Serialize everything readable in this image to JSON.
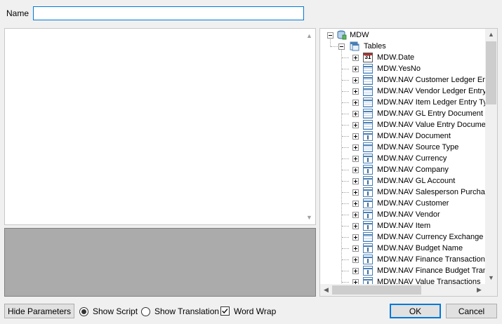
{
  "form": {
    "name_label": "Name",
    "name_value": ""
  },
  "tree": {
    "root": {
      "label": "MDW",
      "icon": "database-icon",
      "expanded": true
    },
    "group": {
      "label": "Tables",
      "icon": "tables-folder-icon",
      "expanded": true
    },
    "items": [
      {
        "label": "MDW.Date",
        "icon": "date-table-icon"
      },
      {
        "label": "MDW.YesNo",
        "icon": "table-icon"
      },
      {
        "label": "MDW.NAV Customer Ledger Ent",
        "icon": "table-icon"
      },
      {
        "label": "MDW.NAV Vendor Ledger Entry",
        "icon": "table-icon"
      },
      {
        "label": "MDW.NAV Item Ledger Entry Ty",
        "icon": "table-icon"
      },
      {
        "label": "MDW.NAV GL Entry Document T",
        "icon": "table-icon"
      },
      {
        "label": "MDW.NAV Value Entry Documen",
        "icon": "table-icon"
      },
      {
        "label": "MDW.NAV Document",
        "icon": "dimension-table-icon"
      },
      {
        "label": "MDW.NAV Source Type",
        "icon": "table-icon"
      },
      {
        "label": "MDW.NAV Currency",
        "icon": "dimension-table-icon"
      },
      {
        "label": "MDW.NAV Company",
        "icon": "dimension-table-icon"
      },
      {
        "label": "MDW.NAV GL Account",
        "icon": "dimension-table-icon"
      },
      {
        "label": "MDW.NAV Salesperson Purchas",
        "icon": "dimension-table-icon"
      },
      {
        "label": "MDW.NAV Customer",
        "icon": "dimension-table-icon"
      },
      {
        "label": "MDW.NAV Vendor",
        "icon": "dimension-table-icon"
      },
      {
        "label": "MDW.NAV Item",
        "icon": "dimension-table-icon"
      },
      {
        "label": "MDW.NAV Currency Exchange I",
        "icon": "table-icon"
      },
      {
        "label": "MDW.NAV Budget Name",
        "icon": "dimension-table-icon"
      },
      {
        "label": "MDW.NAV Finance Transactions",
        "icon": "dimension-table-icon"
      },
      {
        "label": "MDW.NAV Finance Budget Tran",
        "icon": "dimension-table-icon"
      },
      {
        "label": "MDW.NAV Value Transactions",
        "icon": "dimension-table-icon"
      }
    ]
  },
  "footer": {
    "hide_parameters_label": "Hide Parameters",
    "show_script_label": "Show Script",
    "show_script_checked": true,
    "show_translation_label": "Show Translation",
    "show_translation_checked": false,
    "word_wrap_label": "Word Wrap",
    "word_wrap_checked": true,
    "ok_label": "OK",
    "cancel_label": "Cancel"
  },
  "colors": {
    "window_bg": "#f0f0f0",
    "focus_border": "#0078d7",
    "output_bg": "#ababab"
  }
}
